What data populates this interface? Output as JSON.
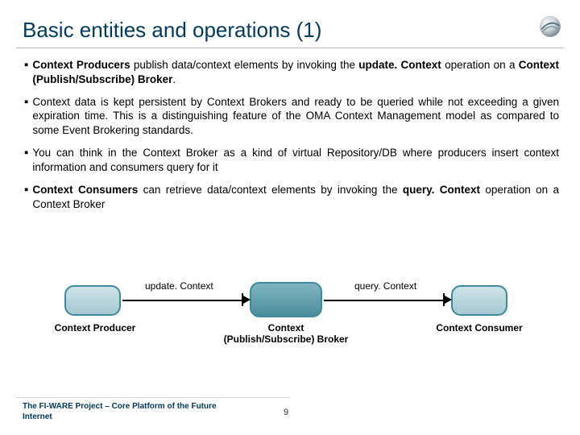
{
  "title": "Basic entities and operations (1)",
  "bullets": [
    "<b>Context Producers</b> publish data/context elements by invoking the <b>update. Context</b> operation on a <b>Context (Publish/Subscribe) Broker</b>.",
    "Context data is kept persistent by Context Brokers and ready to be queried while not exceeding a given expiration time. This is a distinguishing feature of the OMA Context Management model as compared to some Event Brokering standards.",
    "You can think in the Context Broker as a kind of virtual Repository/DB where producers insert context information and consumers query for it",
    "<b>Context Consumers</b> can retrieve data/context elements by invoking the <b>query. Context</b> operation on a Context Broker"
  ],
  "diagram": {
    "arrow1_label": "update. Context",
    "arrow2_label": "query. Context",
    "producer_label": "Context Producer",
    "broker_label": "Context (Publish/Subscribe) Broker",
    "consumer_label": "Context Consumer"
  },
  "footer": "The FI-WARE Project – Core Platform of the Future Internet",
  "page_number": "9"
}
